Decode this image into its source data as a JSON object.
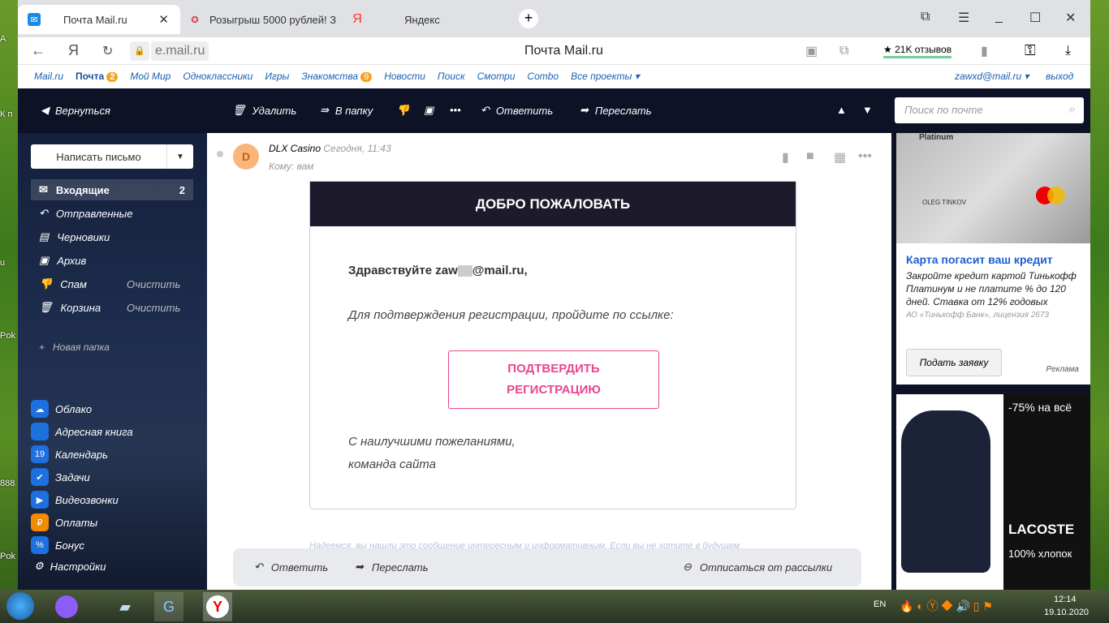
{
  "desktop": {
    "labels": [
      "А",
      "К п",
      "u",
      "Pok",
      "888",
      "Pok"
    ]
  },
  "browser": {
    "tabs": [
      {
        "title": "Почта Mail.ru",
        "active": true
      },
      {
        "title": "Розыгрыш 5000 рублей! З"
      },
      {
        "title": "Яндекс"
      }
    ],
    "address": "e.mail.ru",
    "page_title": "Почта Mail.ru",
    "reviews": "★ 21K отзывов"
  },
  "portal": {
    "links": [
      "Mail.ru",
      "Почта",
      "Мой Мир",
      "Одноклассники",
      "Игры",
      "Знакомства",
      "Новости",
      "Поиск",
      "Смотри",
      "Combo",
      "Все проекты ▾"
    ],
    "mail_badge": "2",
    "dating_badge": "9",
    "user": "zawxd@mail.ru ▾",
    "logout": "выход"
  },
  "toolbar": {
    "back": "Вернуться",
    "delete": "Удалить",
    "to_folder": "В папку",
    "reply": "Ответить",
    "forward": "Переслать",
    "search_placeholder": "Поиск по почте"
  },
  "sidebar": {
    "compose": "Написать письмо",
    "folders": [
      {
        "label": "Входящие",
        "count": "2"
      },
      {
        "label": "Отправленные"
      },
      {
        "label": "Черновики"
      },
      {
        "label": "Архив"
      },
      {
        "label": "Спам",
        "action": "Очистить"
      },
      {
        "label": "Корзина",
        "action": "Очистить"
      }
    ],
    "new_folder": "Новая папка",
    "apps": [
      "Облако",
      "Адресная книга",
      "Календарь",
      "Задачи",
      "Видеозвонки",
      "Оплаты",
      "Бонус",
      "Настройки"
    ]
  },
  "message": {
    "avatar": "D",
    "sender": "DLX Casino",
    "date": "Сегодня, 11:43",
    "to": "Кому: вам",
    "header": "ДОБРО ПОЖАЛОВАТЬ",
    "greeting_a": "Здравствуйте zaw",
    "greeting_b": "@mail.ru,",
    "text": "Для подтверждения регистрации, пройдите по ссылке:",
    "button": "ПОДТВЕРДИТЬ РЕГИСТРАЦИЮ",
    "sign1": "С наилучшими пожеланиями,",
    "sign2": "команда сайта",
    "footer_note": "Надеемся, вы нашли это сообщение интересным и информативным. Если вы не хотите в будущем"
  },
  "bottom": {
    "reply": "Ответить",
    "forward": "Переслать",
    "unsubscribe": "Отписаться от рассылки"
  },
  "ad1": {
    "card_label": "Platinum",
    "card_name": "OLEG TINKOV",
    "title": "Карта погасит ваш кредит",
    "text": "Закройте кредит картой Тинькофф Платинум и не платите % до 120 дней. Ставка от 12% годовых",
    "legal": "АО «Тинькофф Банк», лицензия 2673",
    "button": "Подать заявку",
    "ad_label": "Реклама"
  },
  "ad2": {
    "promo": "-75% на всё",
    "brand": "LACOSTE",
    "material": "100% хлопок"
  },
  "taskbar": {
    "lang": "EN",
    "time": "12:14",
    "date": "19.10.2020"
  }
}
